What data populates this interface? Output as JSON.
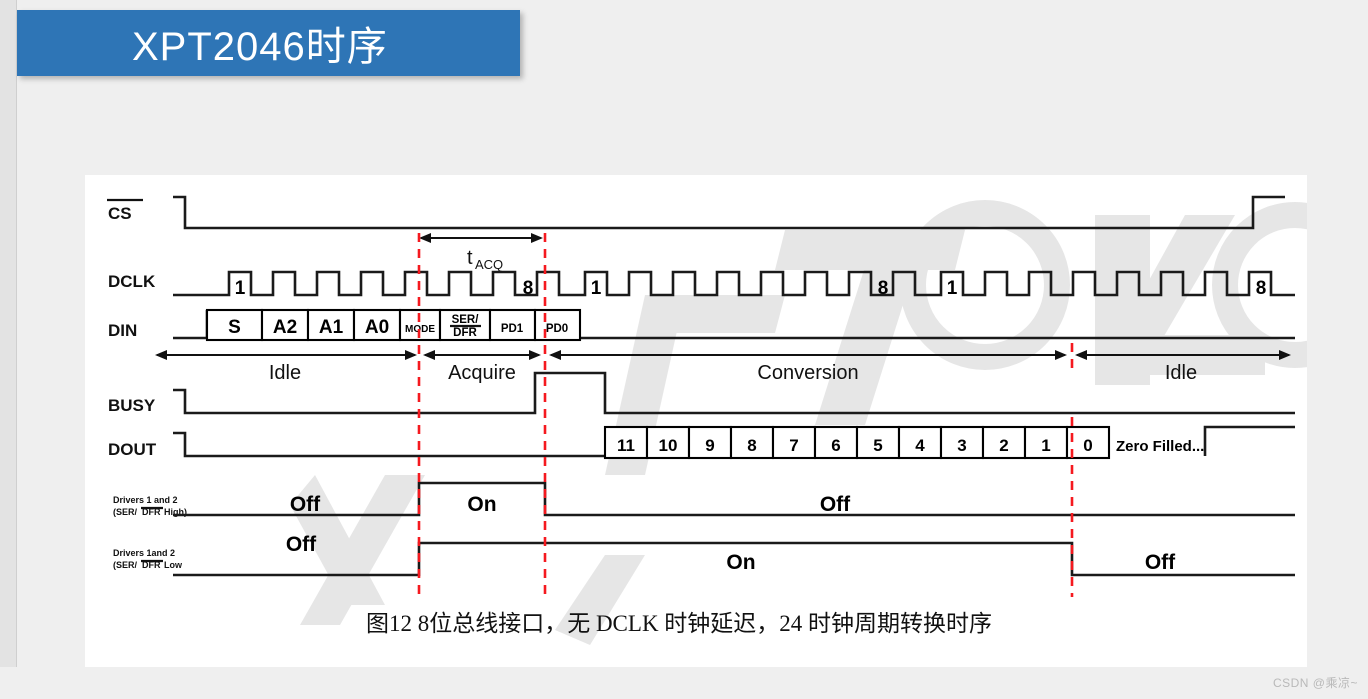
{
  "slide": {
    "title": "XPT2046时序",
    "background_color": "#efefef",
    "banner_color": "#2e75b6",
    "title_color": "#ffffff"
  },
  "watermark": {
    "corner_text": "CSDN @乘凉~",
    "figure_watermark": "XPT2046"
  },
  "figure": {
    "caption": "图12 8位总线接口，无 DCLK 时钟延迟，24 时钟周期转换时序",
    "accent_color": "#f5191f",
    "line_color": "#1a1a1a",
    "signals": [
      {
        "name": "cs",
        "label": "CS",
        "overline": true
      },
      {
        "name": "dclk",
        "label": "DCLK",
        "overline": false
      },
      {
        "name": "din",
        "label": "DIN",
        "overline": false
      },
      {
        "name": "busy",
        "label": "BUSY",
        "overline": false
      },
      {
        "name": "dout",
        "label": "DOUT",
        "overline": false
      }
    ],
    "driver_rows": [
      {
        "name": "drivers-ser-dfr-high",
        "line1": "Drivers 1 and 2",
        "line2_pre": "(SER/",
        "line2_over": "DFR",
        "line2_post": " High)",
        "states": [
          "Off",
          "On",
          "Off"
        ]
      },
      {
        "name": "drivers-ser-dfr-low",
        "line1": "Drivers 1and 2",
        "line2_pre": "(SER/",
        "line2_over": "DFR",
        "line2_post": " Low",
        "states": [
          "Off",
          "On",
          "Off"
        ]
      }
    ],
    "timing_marker": {
      "label_main": "t",
      "label_sub": "ACQ"
    },
    "phases": [
      {
        "name": "idle-1",
        "label": "Idle"
      },
      {
        "name": "acquire",
        "label": "Acquire"
      },
      {
        "name": "conversion",
        "label": "Conversion"
      },
      {
        "name": "idle-2",
        "label": "Idle"
      }
    ],
    "clock_groups": [
      {
        "first": "1",
        "last": "8"
      },
      {
        "first": "1",
        "last": "8"
      },
      {
        "first": "1",
        "last": "8"
      }
    ],
    "din_cells": [
      {
        "text": "S",
        "size": "lg"
      },
      {
        "text": "A2",
        "size": "lg"
      },
      {
        "text": "A1",
        "size": "lg"
      },
      {
        "text": "A0",
        "size": "lg"
      },
      {
        "text": "MODE",
        "size": "xs"
      },
      {
        "text": "SER/DFR",
        "size": "two-line",
        "line1": "SER/",
        "line2": "DFR"
      },
      {
        "text": "PD1",
        "size": "md"
      },
      {
        "text": "PD0",
        "size": "md"
      }
    ],
    "dout_cells": [
      "11",
      "10",
      "9",
      "8",
      "7",
      "6",
      "5",
      "4",
      "3",
      "2",
      "1",
      "0"
    ],
    "dout_tail": "Zero Filled..."
  }
}
